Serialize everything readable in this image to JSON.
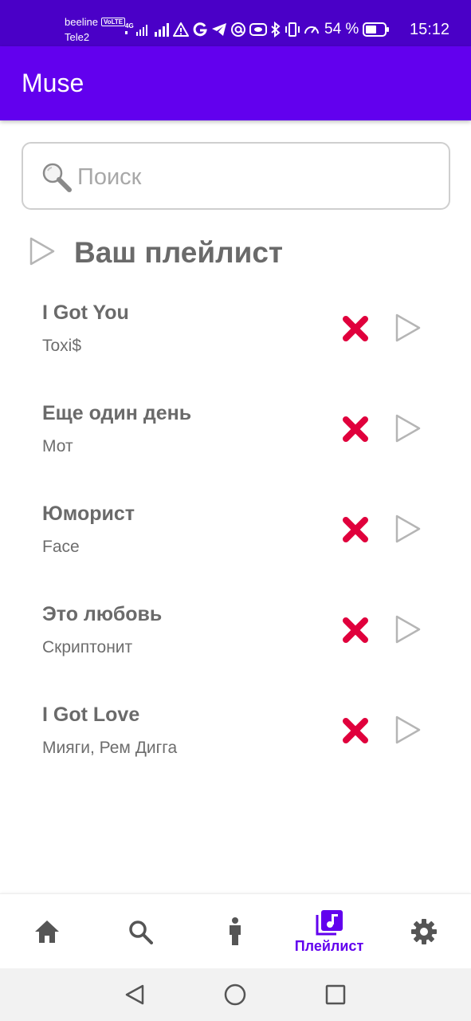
{
  "status_bar": {
    "carrier_1": "beeline",
    "volte": "VoLTE",
    "carrier_2": "Tele2",
    "network_type": "4G",
    "battery_percent": "54 %",
    "time": "15:12",
    "icons": [
      "signal-icon",
      "signal-icon",
      "warning-icon",
      "google-icon",
      "telegram-icon",
      "at-icon",
      "cast-icon",
      "bluetooth-icon",
      "vibrate-icon",
      "speed-icon",
      "battery-icon"
    ]
  },
  "app_bar": {
    "title": "Muse"
  },
  "search": {
    "placeholder": "Поиск",
    "value": ""
  },
  "playlist": {
    "title": "Ваш плейлист",
    "tracks": [
      {
        "title": "I Got You",
        "artist": "Toxi$"
      },
      {
        "title": "Еще один день",
        "artist": "Мот"
      },
      {
        "title": "Юморист",
        "artist": "Face"
      },
      {
        "title": "Это любовь",
        "artist": "Скриптонит"
      },
      {
        "title": "I Got Love",
        "artist": "Мияги, Рем Дигга"
      }
    ]
  },
  "bottom_nav": {
    "items": [
      {
        "icon": "home-icon",
        "label": ""
      },
      {
        "icon": "search-icon",
        "label": ""
      },
      {
        "icon": "person-icon",
        "label": ""
      },
      {
        "icon": "playlist-icon",
        "label": "Плейлист",
        "active": true
      },
      {
        "icon": "settings-icon",
        "label": ""
      }
    ]
  },
  "system_nav": {
    "icons": [
      "back-icon",
      "home-circle-icon",
      "recents-icon"
    ]
  },
  "colors": {
    "status_bar": "#4a00c7",
    "app_bar": "#6200ee",
    "accent": "#6200ee",
    "remove": "#e0003c",
    "text": "#6a6a6a",
    "play_outline": "#b5b5b5"
  }
}
